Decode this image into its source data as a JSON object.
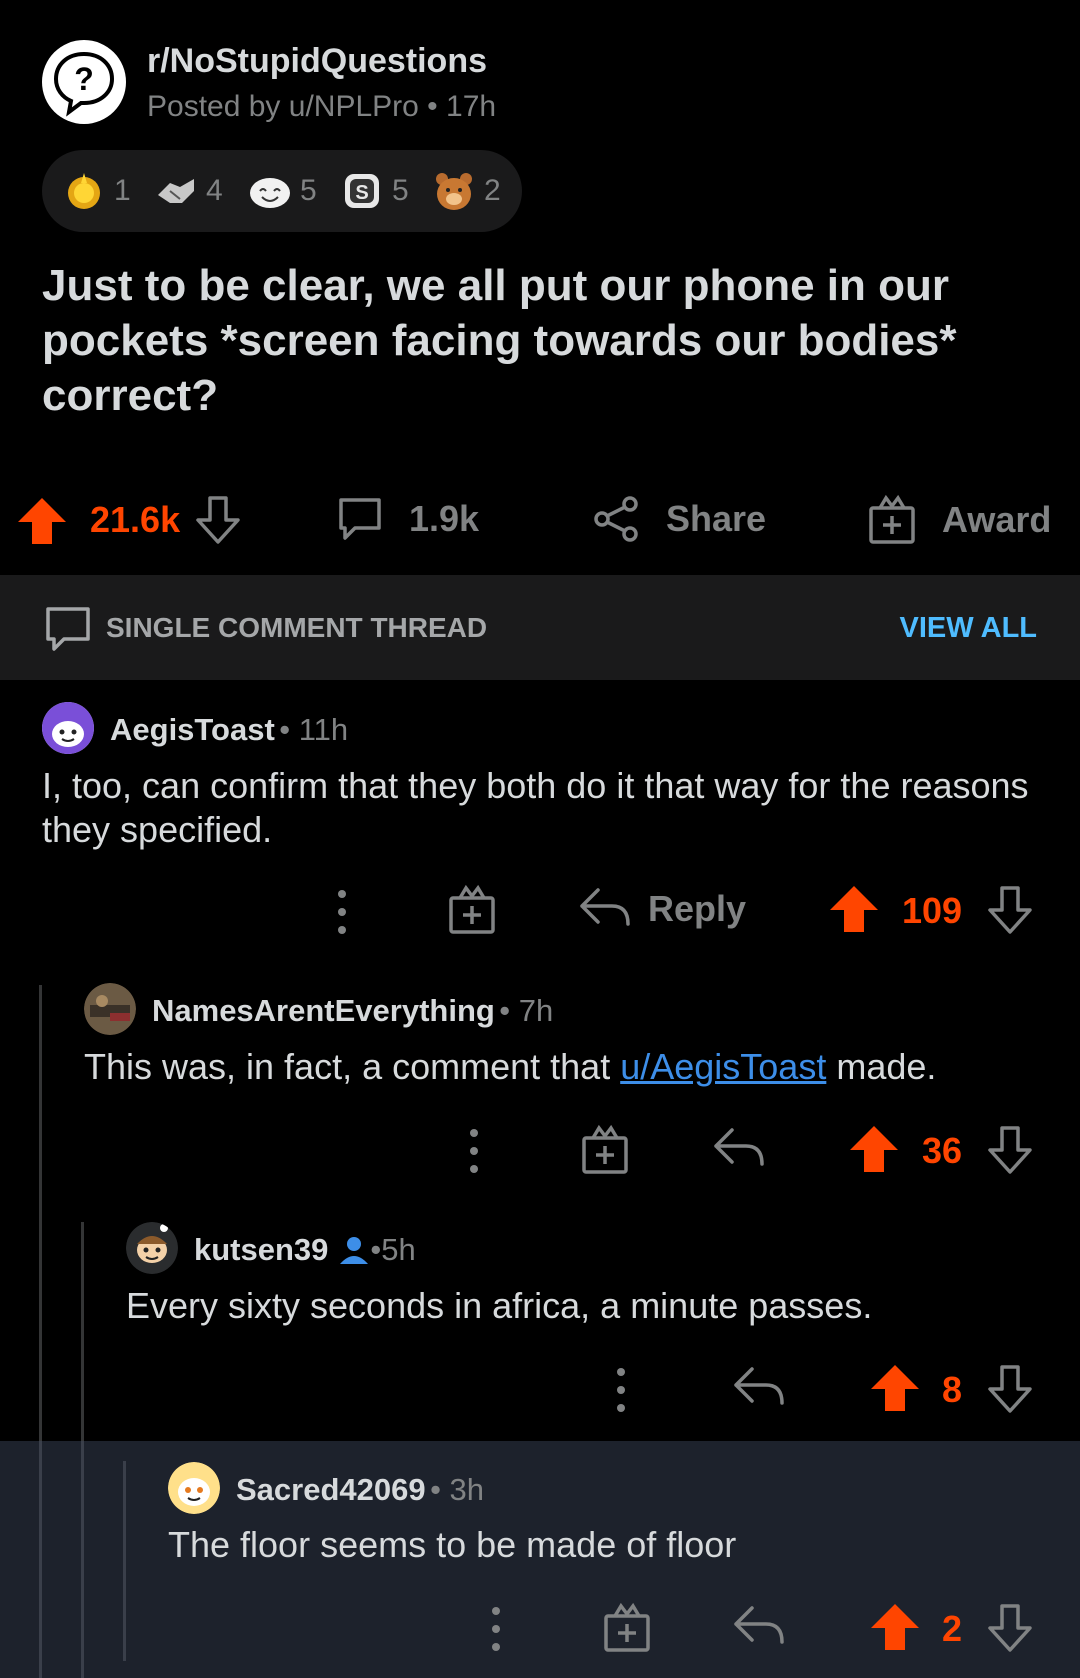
{
  "post": {
    "subreddit": "r/NoStupidQuestions",
    "posted_by": "Posted by u/NPLPro",
    "age": "17h",
    "awards": [
      {
        "icon": "gold-award-icon",
        "count": "1"
      },
      {
        "icon": "handshake-award-icon",
        "count": "4"
      },
      {
        "icon": "laughing-face-award-icon",
        "count": "5"
      },
      {
        "icon": "silver-s-award-icon",
        "count": "5"
      },
      {
        "icon": "bear-award-icon",
        "count": "2"
      }
    ],
    "title": "Just to be clear, we all put our phone in our pockets *screen facing towards our bodies* correct?",
    "votes": "21.6k",
    "comments": "1.9k",
    "share_label": "Share",
    "award_label": "Award"
  },
  "thread": {
    "label": "SINGLE COMMENT THREAD",
    "view_all": "VIEW ALL"
  },
  "comments": [
    {
      "user": "AegisToast",
      "age": "11h",
      "body": "I, too, can confirm that they both do it that way for the reasons they specified.",
      "reply_label": "Reply",
      "votes": "109"
    },
    {
      "user": "NamesArentEverything",
      "age": "7h",
      "body_before": "This was, in fact, a comment that ",
      "body_link": "u/AegisToast",
      "body_after": " made.",
      "votes": "36"
    },
    {
      "user": "kutsen39",
      "age": "5h",
      "body": "Every sixty seconds in africa, a minute passes.",
      "votes": "8"
    },
    {
      "user": "Sacred42069",
      "age": "3h",
      "body": "The floor seems to be made of floor",
      "votes": "2"
    }
  ],
  "colors": {
    "upvote": "#ff4500",
    "link": "#3d8ee8",
    "muted": "#818384",
    "banner_bg": "#1a1a1b",
    "selected_bg": "#1d222c"
  }
}
